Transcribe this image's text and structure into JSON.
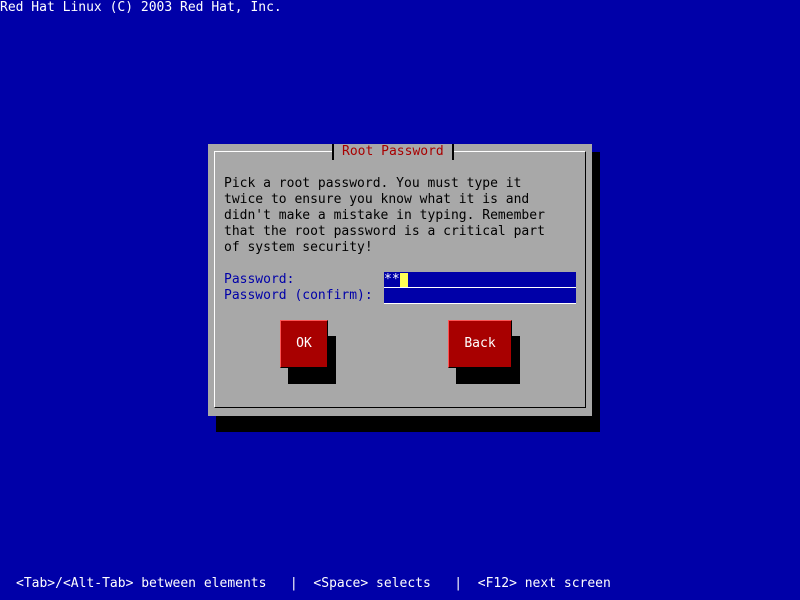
{
  "header": {
    "title": "Red Hat Linux (C) 2003 Red Hat, Inc."
  },
  "dialog": {
    "title": "Root Password",
    "body_lines": [
      "Pick a root password. You must type it",
      "twice to ensure you know what it is and",
      "didn't make a mistake in typing. Remember",
      "that the root password is a critical part",
      "of system security!"
    ],
    "password_label": "Password:",
    "password_value": "**",
    "confirm_label": "Password (confirm):",
    "confirm_value": "",
    "ok_label": "OK",
    "back_label": "Back"
  },
  "footer": {
    "help": "<Tab>/<Alt-Tab> between elements   |  <Space> selects   |  <F12> next screen"
  },
  "colors": {
    "screen_background": "#0000a8",
    "dialog_background": "#a8a8a8",
    "button_background": "#a80000",
    "title_text": "#a80000",
    "label_text": "#0000a8",
    "cursor": "#ffff54"
  }
}
